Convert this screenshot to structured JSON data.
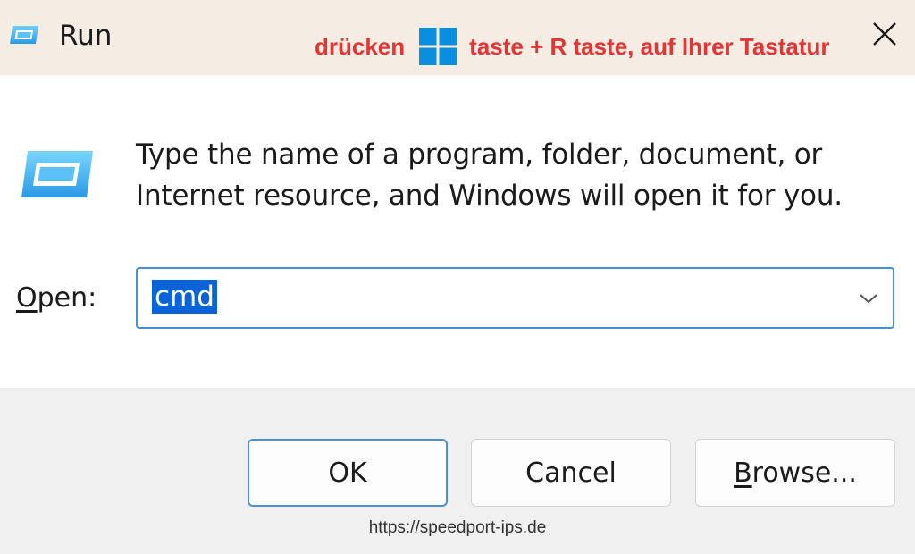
{
  "window": {
    "title": "Run",
    "icon": "run-icon",
    "close_icon": "close-icon"
  },
  "hint": {
    "before_logo": "drücken",
    "logo_icon": "windows-logo-icon",
    "after_logo": "taste + R taste, auf Ihrer Tastatur",
    "color": "#e33535",
    "logo_color": "#0a8ee0"
  },
  "content": {
    "description": "Type the name of a program, folder, document, or Internet resource, and Windows will open it for you.",
    "open_label_mnemonic": "O",
    "open_label_rest": "pen:",
    "open_value": "cmd",
    "dropdown_icon": "chevron-down-icon"
  },
  "buttons": {
    "ok": "OK",
    "cancel": "Cancel",
    "browse_mnemonic": "B",
    "browse_rest": "rowse..."
  },
  "watermark": "https://speedport-ips.de",
  "colors": {
    "accent": "#4a8fd6",
    "selection": "#0a64d8",
    "titlebar_bg": "#f5ece3"
  }
}
